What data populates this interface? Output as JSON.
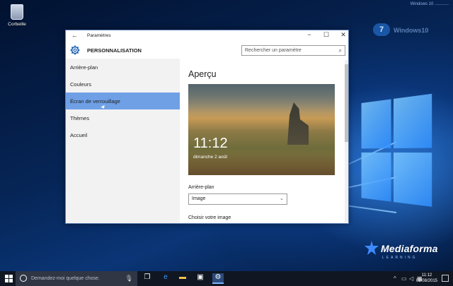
{
  "desktop": {
    "recycle_bin_label": "Corbeille",
    "topright_text": "Windows 10 ............",
    "watermark_text": "Windows10",
    "brand": "Mediaforma",
    "brand_sub": "LEARNING"
  },
  "window": {
    "title": "Paramètres",
    "section": "PERSONNALISATION",
    "search_placeholder": "Rechercher un paramètre",
    "nav_items": [
      {
        "label": "Arrière-plan"
      },
      {
        "label": "Couleurs"
      },
      {
        "label": "Écran de verrouillage"
      },
      {
        "label": "Thèmes"
      },
      {
        "label": "Accueil"
      }
    ],
    "active_nav_index": 2
  },
  "content": {
    "heading": "Aperçu",
    "preview_time": "11:12",
    "preview_date": "dimanche 2 août",
    "background_label": "Arrière-plan",
    "background_value": "Image",
    "choose_image_label": "Choisir votre image"
  },
  "taskbar": {
    "search_placeholder": "Demandez-moi quelque chose.",
    "time": "11:12",
    "date": "02/08/2015"
  },
  "colors": {
    "active_nav": "#6fa0e6",
    "accent": "#2c4a7a"
  }
}
